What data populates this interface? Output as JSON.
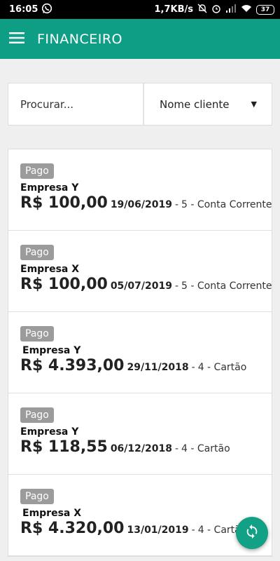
{
  "status_bar": {
    "time": "16:05",
    "speed": "1,7KB/s",
    "battery": "37"
  },
  "app_bar": {
    "title": "FINANCEIRO"
  },
  "filters": {
    "search_placeholder": "Procurar...",
    "sort_selected": "Nome cliente"
  },
  "records": [
    {
      "status": "Pago",
      "company": "Empresa Y",
      "amount": "R$ 100,00",
      "date": "19/06/2019",
      "separator": "-",
      "info": "5 - Conta Corrente"
    },
    {
      "status": "Pago",
      "company": "Empresa X",
      "amount": "R$ 100,00",
      "date": "05/07/2019",
      "separator": "-",
      "info": "5 - Conta Corrente"
    },
    {
      "status": "Pago",
      "company": "Empresa Y",
      "amount": "R$ 4.393,00",
      "date": "29/11/2018",
      "separator": "-",
      "info": "4 - Cartão"
    },
    {
      "status": "Pago",
      "company": "Empresa Y",
      "amount": "R$ 118,55",
      "date": "06/12/2018",
      "separator": "-",
      "info": "4 - Cartão"
    },
    {
      "status": "Pago",
      "company": "Empresa X",
      "amount": "R$ 4.320,00",
      "date": "13/01/2019",
      "separator": "-",
      "info": "4 - Cartão"
    }
  ],
  "icons": {
    "menu": "menu-icon",
    "sync": "sync-icon",
    "whatsapp": "whatsapp-icon",
    "alarm": "alarm-icon",
    "wifi": "wifi-icon",
    "signal": "signal-icon",
    "mute": "mute-icon"
  },
  "colors": {
    "primary": "#0e9e86",
    "fab": "#13a185",
    "badge": "#9b9b9b"
  }
}
